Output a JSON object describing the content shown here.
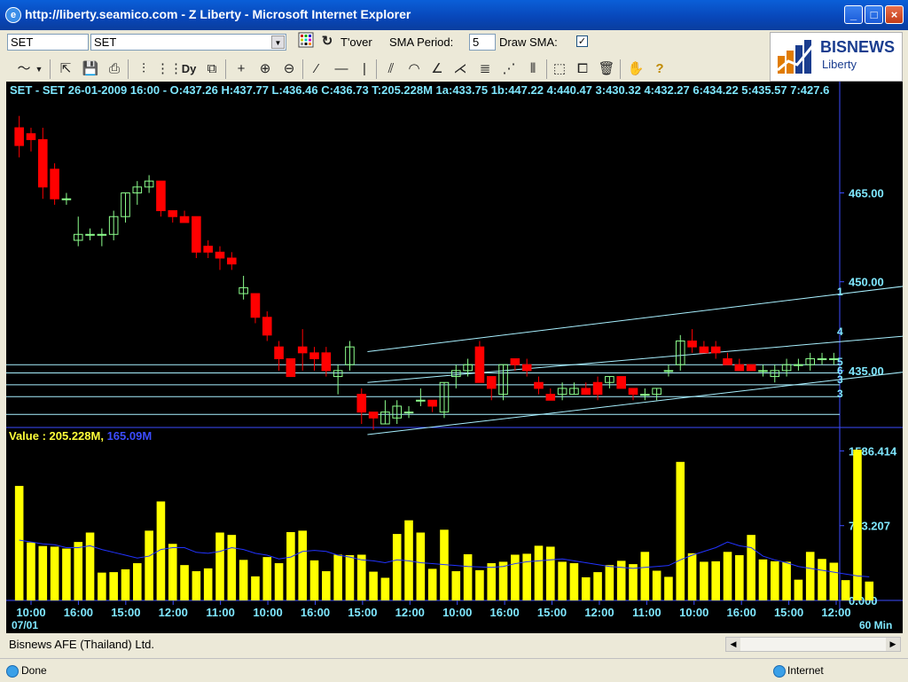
{
  "window": {
    "title": "http://liberty.seamico.com - Z Liberty - Microsoft Internet Explorer",
    "buttons": [
      "_",
      "□",
      "×"
    ]
  },
  "toolbar": {
    "symbol_value": "SET",
    "symbol_select_value": "SET",
    "tover_label": "T'over",
    "sma_period_label": "SMA Period:",
    "sma_period_value": "5",
    "draw_sma_label": "Draw SMA:",
    "draw_sma_checked": "✓"
  },
  "tools": [
    "line-chart-icon",
    "dropdown-arrow-icon",
    "export-icon",
    "save-icon",
    "print-icon",
    "indicator-icon",
    "bars-icon",
    "dy-icon",
    "popout-icon",
    "crosshair-icon",
    "zoom-in-icon",
    "zoom-out-icon",
    "trendline-icon",
    "hline-icon",
    "vline-icon",
    "channel-icon",
    "arc-icon",
    "fan-icon",
    "fan2-icon",
    "fibo-retracement-icon",
    "fibo-fan-icon",
    "cycle-icon",
    "select-icon",
    "copy-icon",
    "delete-icon",
    "hand-icon",
    "help-icon"
  ],
  "logo": {
    "brand": "BISNEWS",
    "sub": "Liberty"
  },
  "chart": {
    "info_line": "SET - SET 26-01-2009 16:00 - O:437.26 H:437.77 L:436.46 C:436.73 T:205.228M 1a:433.75 1b:447.22 4:440.47 3:430.32 4:432.27 6:434.22 5:435.57 7:427.6",
    "value_label": "Value : 205.228M,",
    "value_sma": "165.09M",
    "interval_label": "60 Min",
    "date_label": "07/01"
  },
  "chart_data": {
    "type": "candlestick",
    "price_axis": {
      "ticks": [
        "465.00",
        "450.00",
        "435.00"
      ]
    },
    "volume_axis": {
      "ticks": [
        "1586.414",
        "793.207",
        "0.000"
      ]
    },
    "x_tick_labels": [
      "10:00",
      "16:00",
      "15:00",
      "12:00",
      "11:00",
      "10:00",
      "16:00",
      "15:00",
      "12:00",
      "10:00",
      "16:00",
      "15:00",
      "12:00",
      "11:00",
      "10:00",
      "16:00",
      "15:00",
      "12:00"
    ],
    "right_edge_labels": [
      "1",
      "4",
      "5",
      "6",
      "3",
      "3"
    ],
    "colors": {
      "up": "#8dff8d",
      "down": "#ff0000",
      "volume": "#ffff00",
      "sma": "#2233ff",
      "lines": "#a8f0ff"
    },
    "candles": [
      {
        "o": 476,
        "h": 478,
        "l": 471,
        "c": 473
      },
      {
        "o": 475,
        "h": 476,
        "l": 472,
        "c": 474
      },
      {
        "o": 474,
        "h": 476,
        "l": 464,
        "c": 466
      },
      {
        "o": 469,
        "h": 470,
        "l": 463,
        "c": 464
      },
      {
        "o": 464,
        "h": 465,
        "l": 463,
        "c": 464
      },
      {
        "o": 457,
        "h": 461,
        "l": 456,
        "c": 458
      },
      {
        "o": 458,
        "h": 459,
        "l": 457,
        "c": 458
      },
      {
        "o": 458,
        "h": 459,
        "l": 456,
        "c": 458
      },
      {
        "o": 458,
        "h": 462,
        "l": 457,
        "c": 461
      },
      {
        "o": 461,
        "h": 465,
        "l": 460,
        "c": 465
      },
      {
        "o": 465,
        "h": 467,
        "l": 463,
        "c": 466
      },
      {
        "o": 466,
        "h": 468,
        "l": 465,
        "c": 467
      },
      {
        "o": 467,
        "h": 467,
        "l": 461,
        "c": 462
      },
      {
        "o": 462,
        "h": 462,
        "l": 460,
        "c": 461
      },
      {
        "o": 461,
        "h": 462,
        "l": 460,
        "c": 460
      },
      {
        "o": 461,
        "h": 461,
        "l": 454,
        "c": 455
      },
      {
        "o": 456,
        "h": 457,
        "l": 454,
        "c": 455
      },
      {
        "o": 455,
        "h": 456,
        "l": 452,
        "c": 454
      },
      {
        "o": 454,
        "h": 455,
        "l": 452,
        "c": 453
      },
      {
        "o": 448,
        "h": 451,
        "l": 447,
        "c": 449
      },
      {
        "o": 448,
        "h": 448,
        "l": 443,
        "c": 444
      },
      {
        "o": 444,
        "h": 445,
        "l": 440,
        "c": 441
      },
      {
        "o": 439,
        "h": 440,
        "l": 435,
        "c": 437
      },
      {
        "o": 437,
        "h": 437,
        "l": 434,
        "c": 434
      },
      {
        "o": 439,
        "h": 442,
        "l": 435,
        "c": 438
      },
      {
        "o": 438,
        "h": 439,
        "l": 435,
        "c": 437
      },
      {
        "o": 438,
        "h": 439,
        "l": 434,
        "c": 435
      },
      {
        "o": 434,
        "h": 436,
        "l": 431,
        "c": 435
      },
      {
        "o": 436,
        "h": 440,
        "l": 435,
        "c": 439
      },
      {
        "o": 431,
        "h": 432,
        "l": 426,
        "c": 428
      },
      {
        "o": 428,
        "h": 428,
        "l": 425,
        "c": 427
      },
      {
        "o": 426,
        "h": 430,
        "l": 426,
        "c": 428
      },
      {
        "o": 427,
        "h": 430,
        "l": 426,
        "c": 429
      },
      {
        "o": 428,
        "h": 429,
        "l": 427,
        "c": 428
      },
      {
        "o": 430,
        "h": 432,
        "l": 429,
        "c": 430
      },
      {
        "o": 430,
        "h": 430,
        "l": 428,
        "c": 429
      },
      {
        "o": 428,
        "h": 433,
        "l": 427,
        "c": 433
      },
      {
        "o": 434,
        "h": 436,
        "l": 432,
        "c": 435
      },
      {
        "o": 435,
        "h": 437,
        "l": 434,
        "c": 436
      },
      {
        "o": 439,
        "h": 440,
        "l": 433,
        "c": 433
      },
      {
        "o": 434,
        "h": 434,
        "l": 430,
        "c": 432
      },
      {
        "o": 431,
        "h": 436,
        "l": 430,
        "c": 436
      },
      {
        "o": 437,
        "h": 437,
        "l": 435,
        "c": 436
      },
      {
        "o": 436,
        "h": 437,
        "l": 434,
        "c": 435
      },
      {
        "o": 433,
        "h": 434,
        "l": 431,
        "c": 432
      },
      {
        "o": 431,
        "h": 432,
        "l": 430,
        "c": 430
      },
      {
        "o": 431,
        "h": 433,
        "l": 430,
        "c": 432
      },
      {
        "o": 431,
        "h": 433,
        "l": 431,
        "c": 432
      },
      {
        "o": 432,
        "h": 433,
        "l": 431,
        "c": 431
      },
      {
        "o": 433,
        "h": 434,
        "l": 430,
        "c": 431
      },
      {
        "o": 433,
        "h": 434,
        "l": 432,
        "c": 434
      },
      {
        "o": 434,
        "h": 434,
        "l": 432,
        "c": 432
      },
      {
        "o": 432,
        "h": 432,
        "l": 430,
        "c": 431
      },
      {
        "o": 431,
        "h": 432,
        "l": 430,
        "c": 431
      },
      {
        "o": 431,
        "h": 432,
        "l": 430,
        "c": 432
      },
      {
        "o": 435,
        "h": 436,
        "l": 434,
        "c": 435
      },
      {
        "o": 436,
        "h": 441,
        "l": 435,
        "c": 440
      },
      {
        "o": 440,
        "h": 442,
        "l": 438,
        "c": 439
      },
      {
        "o": 439,
        "h": 440,
        "l": 438,
        "c": 438
      },
      {
        "o": 439,
        "h": 440,
        "l": 437,
        "c": 438
      },
      {
        "o": 437,
        "h": 438,
        "l": 436,
        "c": 436
      },
      {
        "o": 436,
        "h": 437,
        "l": 435,
        "c": 435
      },
      {
        "o": 436,
        "h": 436,
        "l": 435,
        "c": 435
      },
      {
        "o": 435,
        "h": 436,
        "l": 434,
        "c": 435
      },
      {
        "o": 434,
        "h": 436,
        "l": 433,
        "c": 435
      },
      {
        "o": 435,
        "h": 437,
        "l": 434,
        "c": 436
      },
      {
        "o": 436,
        "h": 437,
        "l": 435,
        "c": 436
      },
      {
        "o": 436,
        "h": 438,
        "l": 435,
        "c": 437
      },
      {
        "o": 437,
        "h": 438,
        "l": 436,
        "c": 437
      },
      {
        "o": 437,
        "h": 438,
        "l": 436,
        "c": 437
      }
    ],
    "volumes": [
      1215,
      615,
      577,
      570,
      550,
      620,
      720,
      295,
      300,
      330,
      395,
      740,
      1050,
      600,
      375,
      310,
      340,
      720,
      695,
      430,
      255,
      460,
      395,
      725,
      740,
      425,
      310,
      485,
      480,
      485,
      305,
      240,
      705,
      850,
      720,
      335,
      750,
      310,
      490,
      320,
      395,
      410,
      485,
      495,
      580,
      570,
      410,
      395,
      245,
      300,
      375,
      420,
      385,
      515,
      315,
      250,
      1470,
      500,
      410,
      415,
      515,
      480,
      695,
      435,
      415,
      410,
      220,
      515,
      440,
      400,
      215,
      1600,
      200
    ],
    "volume_sma": [
      640,
      620,
      600,
      590,
      560,
      560,
      580,
      540,
      510,
      480,
      450,
      470,
      540,
      560,
      560,
      510,
      500,
      520,
      560,
      540,
      500,
      480,
      440,
      460,
      520,
      530,
      520,
      480,
      460,
      430,
      420,
      400,
      430,
      420,
      400,
      390,
      380,
      370,
      360,
      355,
      350,
      360,
      390,
      410,
      420,
      430,
      440,
      420,
      400,
      380,
      360,
      350,
      340,
      350,
      360,
      370,
      430,
      480,
      520,
      560,
      620,
      580,
      560,
      470,
      430,
      400,
      360,
      340,
      320,
      300,
      280,
      260,
      250
    ]
  }
}
